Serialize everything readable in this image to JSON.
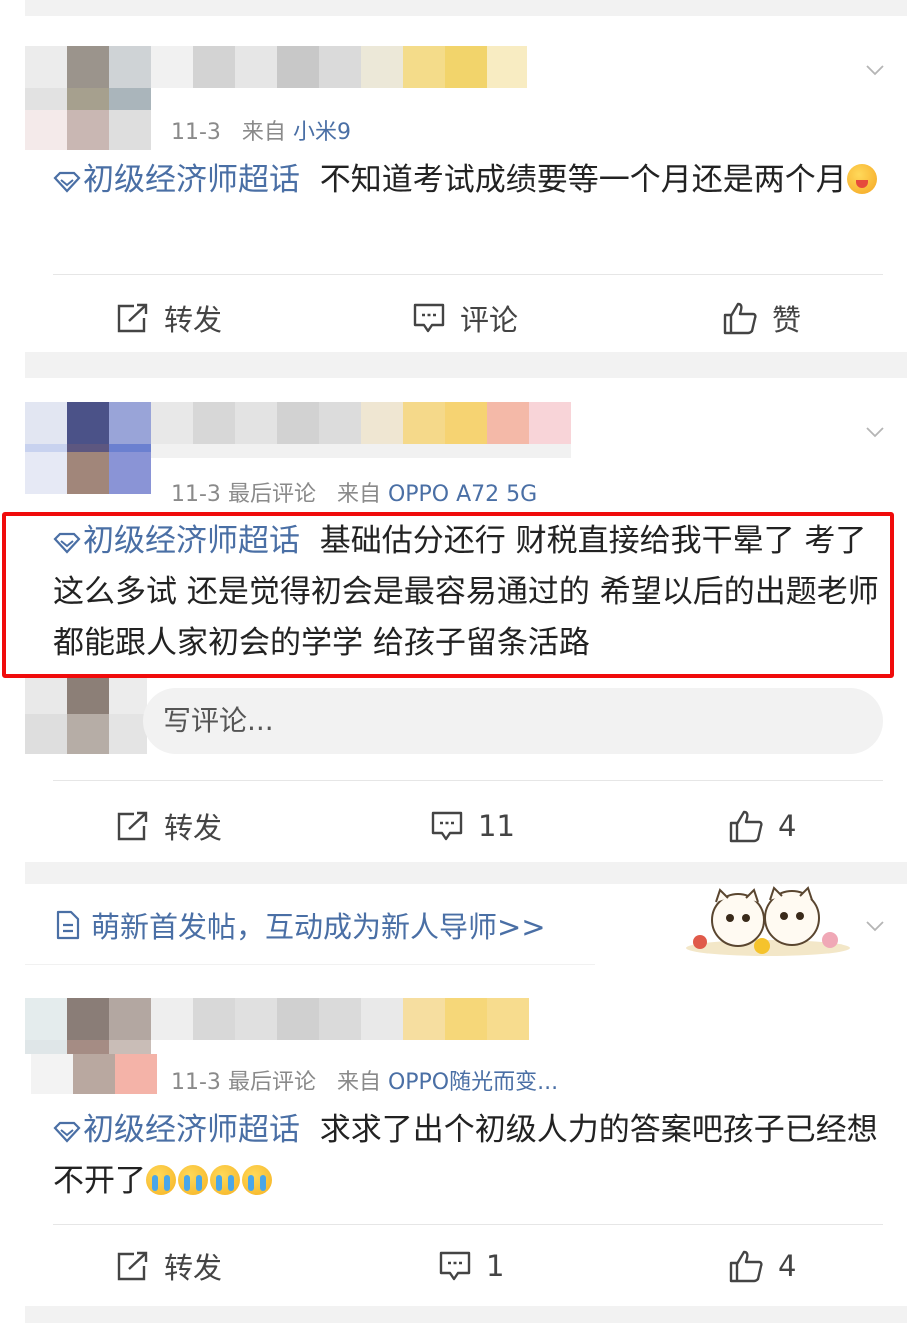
{
  "posts": [
    {
      "date": "11-3",
      "last_comment": "",
      "source_prefix": "来自",
      "source": "小米9",
      "topic": "初级经济师超话",
      "text": "不知道考试成绩要等一个月还是两个月",
      "emoji": [
        "laugh-tongue-emoji"
      ],
      "actions": {
        "repost": "转发",
        "comment": "评论",
        "like": "赞"
      }
    },
    {
      "date": "11-3",
      "last_comment": "最后评论",
      "source_prefix": "来自",
      "source": "OPPO A72 5G",
      "topic": "初级经济师超话",
      "text": "基础估分还行 财税直接给我干晕了 考了这么多试 还是觉得初会是最容易通过的 希望以后的出题老师都能跟人家初会的学学 给孩子留条活路",
      "comment_placeholder": "写评论...",
      "actions": {
        "repost": "转发",
        "comment": "11",
        "like": "4"
      }
    },
    {
      "date": "11-3",
      "last_comment": "最后评论",
      "source_prefix": "来自",
      "source": "OPPO随光而变...",
      "topic": "初级经济师超话",
      "text": "求求了出个初级人力的答案吧孩子已经想不开了",
      "emoji": [
        "crying-emoji",
        "crying-emoji",
        "crying-emoji",
        "crying-emoji"
      ],
      "actions": {
        "repost": "转发",
        "comment": "1",
        "like": "4"
      }
    }
  ],
  "banner": {
    "text": "萌新首发帖，互动成为新人导师>>",
    "icon": "document-icon"
  },
  "colors": {
    "link": "#4a6fa5",
    "highlight": "#f00b0b",
    "separator": "#f2f2f2"
  }
}
